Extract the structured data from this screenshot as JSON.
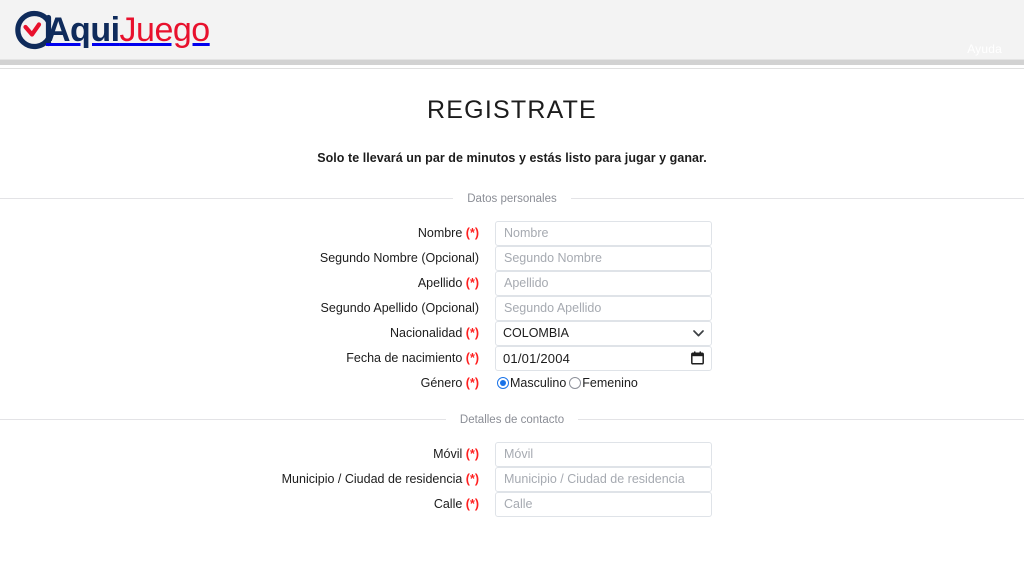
{
  "header": {
    "logo": {
      "icon": "aquijuego-circle-check-logo",
      "text_primary": "Aqui",
      "text_secondary": "Juego",
      "color_primary": "#0f2b5b",
      "color_secondary": "#e8112d"
    },
    "help_label": "Ayuda",
    "background_color": "#f3f3f3"
  },
  "page": {
    "title": "REGISTRATE",
    "subtitle": "Solo te llevará un par de minutos y estás listo para jugar y ganar."
  },
  "sections": [
    {
      "legend": "Datos personales",
      "fields": [
        {
          "name": "nombre",
          "label": "Nombre",
          "required": true,
          "required_marker": "(*)",
          "type": "text",
          "placeholder": "Nombre",
          "value": ""
        },
        {
          "name": "segundo-nombre",
          "label": "Segundo Nombre (Opcional)",
          "required": false,
          "required_marker": "",
          "type": "text",
          "placeholder": "Segundo Nombre",
          "value": ""
        },
        {
          "name": "apellido",
          "label": "Apellido",
          "required": true,
          "required_marker": "(*)",
          "type": "text",
          "placeholder": "Apellido",
          "value": ""
        },
        {
          "name": "segundo-apellido",
          "label": "Segundo Apellido (Opcional)",
          "required": false,
          "required_marker": "",
          "type": "text",
          "placeholder": "Segundo Apellido",
          "value": ""
        },
        {
          "name": "nacionalidad",
          "label": "Nacionalidad",
          "required": true,
          "required_marker": "(*)",
          "type": "select",
          "selected": "COLOMBIA",
          "options": [
            "COLOMBIA"
          ],
          "icon": "chevron-down-icon"
        },
        {
          "name": "fecha-nacimiento",
          "label": "Fecha de nacimiento",
          "required": true,
          "required_marker": "(*)",
          "type": "date",
          "value": "01/01/2004",
          "icon": "calendar-icon"
        },
        {
          "name": "genero",
          "label": "Género",
          "required": true,
          "required_marker": "(*)",
          "type": "radio",
          "options": [
            {
              "label": "Masculino",
              "checked": true
            },
            {
              "label": "Femenino",
              "checked": false
            }
          ]
        }
      ]
    },
    {
      "legend": "Detalles de contacto",
      "fields": [
        {
          "name": "movil",
          "label": "Móvil",
          "required": true,
          "required_marker": "(*)",
          "type": "text",
          "placeholder": "Móvil",
          "value": ""
        },
        {
          "name": "municipio",
          "label": "Municipio / Ciudad de residencia",
          "required": true,
          "required_marker": "(*)",
          "type": "text",
          "placeholder": "Municipio / Ciudad de residencia",
          "value": ""
        },
        {
          "name": "calle",
          "label": "Calle",
          "required": true,
          "required_marker": "(*)",
          "type": "text",
          "placeholder": "Calle",
          "value": ""
        }
      ]
    }
  ],
  "colors": {
    "accent_red": "#e8112d",
    "navy": "#0f2b5b",
    "required_red": "#ff2020",
    "radio_blue": "#1a73e8",
    "input_border": "#dfe3e8",
    "placeholder": "#a6aab1",
    "legend_text": "#8b8e96"
  }
}
